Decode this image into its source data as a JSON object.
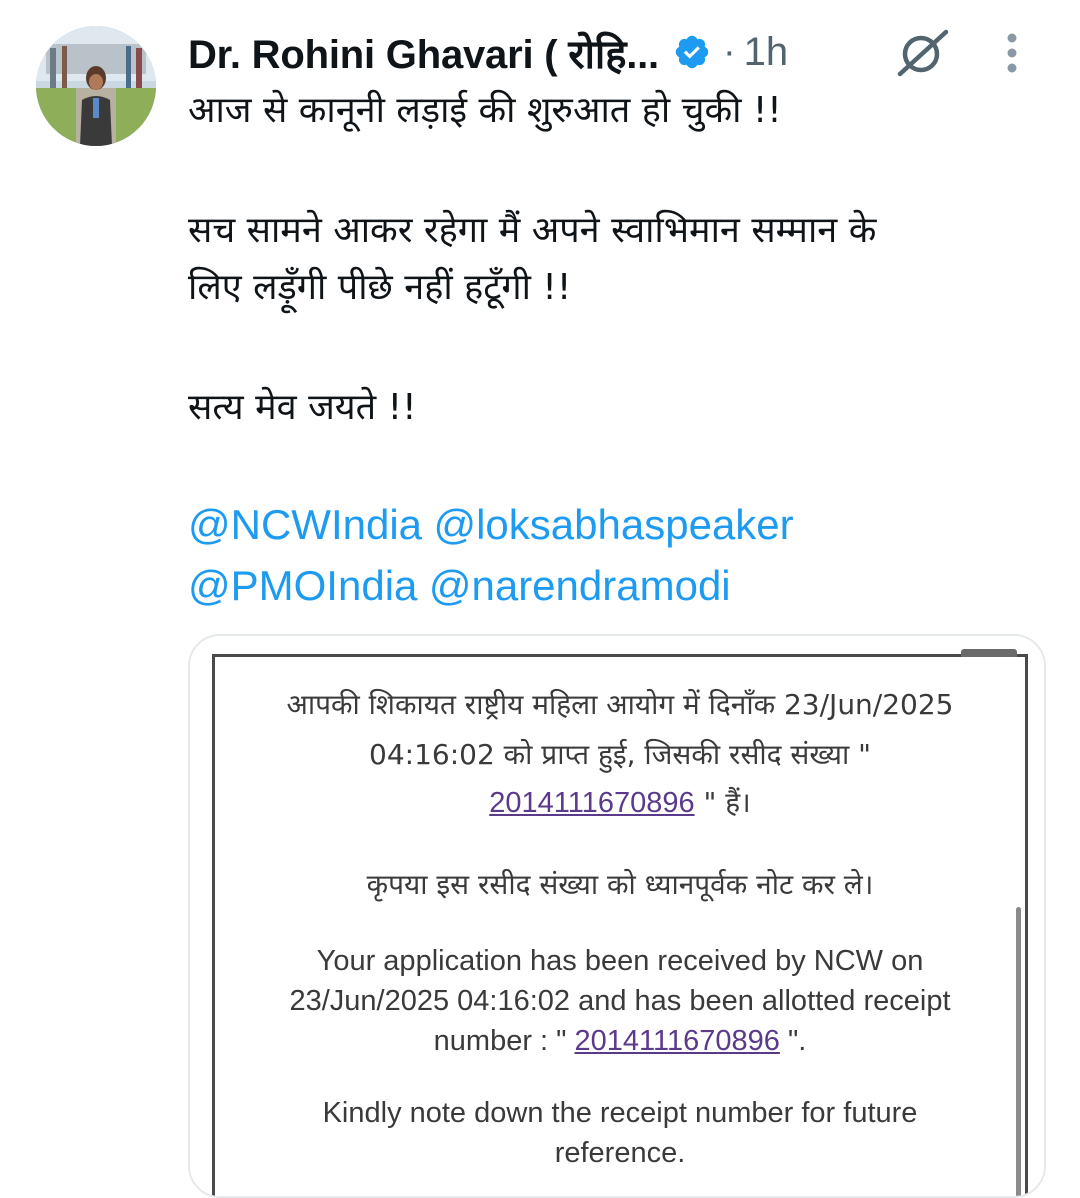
{
  "header": {
    "display_name": "Dr. Rohini Ghavari ( रोहि...",
    "separator": "·",
    "timestamp": "1h"
  },
  "icons": {
    "verified": "verified-badge-icon",
    "grok": "grok-icon",
    "more": "more-options-icon"
  },
  "colors": {
    "mention": "#1d9bf0",
    "verified": "#1d9bf0",
    "secondary_text": "#536471",
    "receipt_link": "#5b3a8c"
  },
  "tweet": {
    "line1": "आज से कानूनी लड़ाई की शुरुआत हो चुकी !!",
    "line2": "सच सामने आकर रहेगा मैं अपने स्वाभिमान सम्मान के",
    "line3": "लिए लड़ूँगी पीछे नहीं हटूँगी !!",
    "line4": "सत्य मेव जयते !!",
    "mentions": [
      "@NCWIndia",
      "@loksabhaspeaker",
      "@PMOIndia",
      "@narendramodi"
    ]
  },
  "media": {
    "hi_line1": "आपकी शिकायत राष्ट्रीय महिला आयोग में दिनाँक 23/Jun/2025",
    "hi_line2": "04:16:02 को प्राप्त हुई, जिसकी रसीद संख्या \"",
    "receipt_number": "2014111670896",
    "hi_line3_suffix": " \" हैं।",
    "hi_note": "कृपया इस रसीद संख्या को ध्यानपूर्वक नोट कर ले।",
    "en_line1": "Your application has been received by NCW on",
    "en_line2": "23/Jun/2025 04:16:02 and has been allotted receipt",
    "en_line3_prefix": "number : \" ",
    "en_line3_suffix": " \".",
    "en_note1": "Kindly note down the receipt number for future",
    "en_note2": "reference."
  }
}
